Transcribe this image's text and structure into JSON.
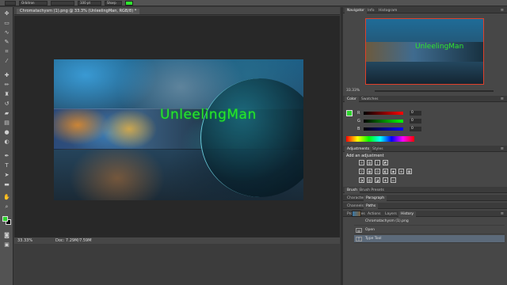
{
  "options_bar": {
    "font_family": "Orbitron",
    "font_size": "100 pt",
    "antialias": "Sharp",
    "text_color": "#2ee62e"
  },
  "toolbar": {
    "tools": [
      "move-icon",
      "marquee-icon",
      "lasso-icon",
      "quick-select-icon",
      "crop-icon",
      "eyedropper-icon",
      "healing-icon",
      "brush-icon",
      "clone-stamp-icon",
      "history-brush-icon",
      "eraser-icon",
      "gradient-icon",
      "blur-icon",
      "dodge-icon",
      "pen-icon",
      "type-icon",
      "path-select-icon",
      "shape-icon",
      "hand-icon",
      "zoom-icon"
    ],
    "foreground_color": "#2ed42e",
    "background_color": "#000000"
  },
  "document": {
    "tab_title": "Chromatachysm (1).png @ 33.3% (UnleelingMan, RGB/8) *",
    "channel_name": "UnleelingMan",
    "zoom": "33.33%",
    "doc_size": "Doc: 7.29M/7.59M"
  },
  "navigator": {
    "tabs": [
      "Navigator",
      "Info",
      "Histogram"
    ],
    "active_tab": "Navigator",
    "thumb_title": "UnleelingMan",
    "zoom": "33.33%"
  },
  "color_panel": {
    "tabs": [
      "Color",
      "Swatches"
    ],
    "active_tab": "Color",
    "channels": [
      {
        "label": "R",
        "value": "0"
      },
      {
        "label": "G",
        "value": "0"
      },
      {
        "label": "B",
        "value": "0"
      }
    ]
  },
  "adjustments": {
    "tabs": [
      "Adjustments",
      "Styles"
    ],
    "active_tab": "Adjustments",
    "label": "Add an adjustment"
  },
  "brush_tabs": [
    "Brush",
    "Brush Presets"
  ],
  "character_tabs": [
    "Character",
    "Paragraph"
  ],
  "channels_tabs": [
    "Channels",
    "Paths"
  ],
  "history": {
    "tabs": [
      "Properties",
      "Actions",
      "Layers",
      "History"
    ],
    "active_tab": "History",
    "items": [
      {
        "label": "Chromatachysm (1).png"
      },
      {
        "label": "Open"
      },
      {
        "label": "Type Tool"
      }
    ]
  }
}
